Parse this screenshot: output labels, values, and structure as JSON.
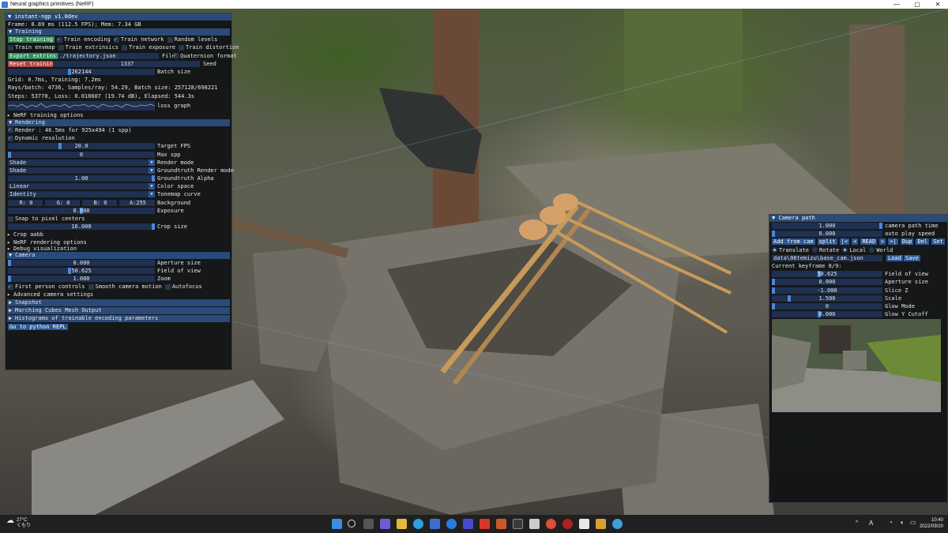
{
  "window": {
    "title": "Neural graphics primitives (NeRF)",
    "minimize": "—",
    "maximize": "▢",
    "close": "✕"
  },
  "main_panel": {
    "title": "instant-ngp v1.0dev",
    "frame_info": "Frame: 8.89 ms (112.5 FPS); Mem: 7.34 GB",
    "training": {
      "header": "Training",
      "stop_training": "Stop training",
      "train_encoding": "Train encoding",
      "train_network": "Train network",
      "random_levels": "Random levels",
      "train_envmap": "Train envmap",
      "train_extrinsics": "Train extrinsics",
      "train_exposure": "Train exposure",
      "train_distortion": "Train distortion",
      "export_extrinsics": "Export extrinsics",
      "trajectory_file": "./trajectory.json",
      "file_label": "File",
      "quaternion_format": "Quaternion format",
      "reset_training": "Reset training",
      "seed_value": "1337",
      "seed_label": "Seed",
      "batch_size_value": "262144",
      "batch_size_label": "Batch size",
      "batch_size_fraction": 0.42,
      "stats_grid": "Grid: 0.7ms, Training: 7.2ms",
      "stats_rays": "Rays/batch: 4736, Samples/ray: 54.29, Batch size: 257128/698221",
      "stats_steps": "Steps: 53770, Loss: 0.018607 (19.74 dB), Elapsed: 544.3s",
      "loss_graph_label": "loss graph",
      "nerf_training_options": "NeRF training options"
    },
    "rendering": {
      "header": "Rendering",
      "render_info": "Render : 46.5ms for 925x494 (1 spp)",
      "dynamic_resolution": "Dynamic resolution",
      "target_fps_value": "20.0",
      "target_fps_label": "Target FPS",
      "target_fps_fraction": 0.35,
      "max_spp_value": "0",
      "max_spp_label": "Max spp",
      "render_mode_value": "Shade",
      "render_mode_label": "Render mode",
      "gt_render_mode_value": "Shade",
      "gt_render_mode_label": "Groundtruth Render mode",
      "gt_alpha_value": "1.00",
      "gt_alpha_label": "Groundtruth Alpha",
      "color_space_value": "Linear",
      "color_space_label": "Color space",
      "tonemap_value": "Identity",
      "tonemap_label": "Tonemap curve",
      "bg_r": "R:  0",
      "bg_g": "G:  0",
      "bg_b": "B:  0",
      "bg_a": "A:255",
      "background_label": "Background",
      "exposure_value": "0.000",
      "exposure_label": "Exposure",
      "exposure_fraction": 0.5,
      "snap_to_pixel": "Snap to pixel centers",
      "crop_size_value": "16.000",
      "crop_size_label": "Crop size",
      "crop_size_fraction": 1.0,
      "crop_aabb": "Crop aabb",
      "nerf_rendering_options": "NeRF rendering options",
      "debug_visualization": "Debug visualization"
    },
    "camera": {
      "header": "Camera",
      "aperture_value": "0.000",
      "aperture_label": "Aperture size",
      "fov_value": "50.625",
      "fov_label": "Field of view",
      "fov_fraction": 0.42,
      "zoom_value": "1.000",
      "zoom_label": "Zoom",
      "first_person": "First person controls",
      "smooth_motion": "Smooth camera motion",
      "autofocus": "Autofocus",
      "advanced_settings": "Advanced camera settings"
    },
    "snapshot": "Snapshot",
    "marching_cubes": "Marching Cubes Mesh Output",
    "histograms": "Histograms of trainable encoding parameters",
    "python_repl": "Go to python REPL"
  },
  "camera_path_panel": {
    "header": "Camera path",
    "path_time_value": "1.000",
    "path_time_label": "camera path time",
    "auto_play_value": "0.000",
    "auto_play_label": "auto play speed",
    "add_from_cam": "Add from cam",
    "split": "split",
    "first": "|<",
    "prev": "<",
    "read": "READ",
    "next": ">",
    "last": ">|",
    "dup": "Dup",
    "del": "Del",
    "set": "Set",
    "translate": "Translate",
    "rotate": "Rotate",
    "local": "Local",
    "world": "World",
    "cam_file": "data\\08temizu\\base_cam.json",
    "load": "Load",
    "save": "Save",
    "current_keyframe": "Current keyframe 8/9:",
    "kf_fov_value": "50.625",
    "kf_fov_label": "Field of view",
    "kf_aperture_value": "0.000",
    "kf_aperture_label": "Aperture size",
    "slice_z_value": "-1.000",
    "slice_z_label": "Slice Z",
    "scale_value": "1.500",
    "scale_label": "Scale",
    "glow_mode_value": "0",
    "glow_mode_label": "Glow Mode",
    "glow_y_value": "0.000",
    "glow_y_label": "Glow Y Cutoff"
  },
  "taskbar": {
    "temperature": "27°C",
    "weather_desc": "くもり",
    "time": "10:40",
    "date": "2022/09/20",
    "ime": "A"
  }
}
